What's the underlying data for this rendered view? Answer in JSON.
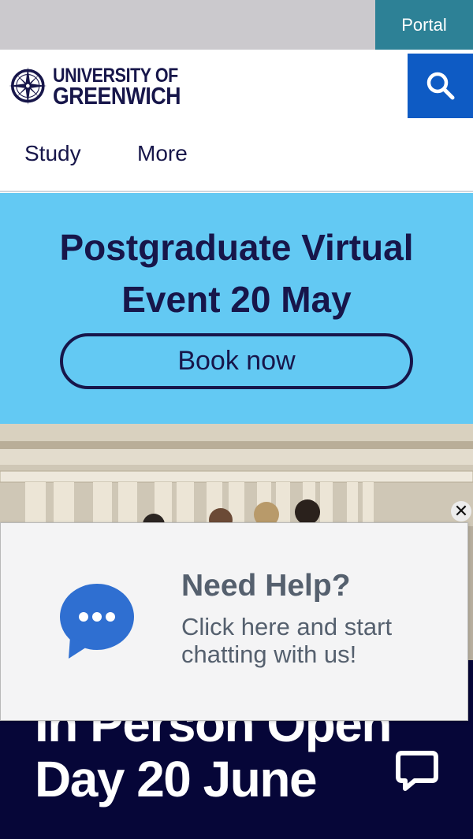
{
  "utility": {
    "portal_label": "Portal"
  },
  "header": {
    "logo_line1": "UNIVERSITY OF",
    "logo_line2": "GREENWICH"
  },
  "nav": {
    "items": [
      {
        "label": "Study"
      },
      {
        "label": "More"
      }
    ]
  },
  "promo": {
    "title_line1": "Postgraduate Virtual",
    "title_line2": "Event 20 May",
    "button_label": "Book now"
  },
  "dark_banner": {
    "title_line1": "In Person Open",
    "title_line2": "Day 20 June"
  },
  "chat_popup": {
    "heading": "Need Help?",
    "message_line1": "Click here and start",
    "message_line2": "chatting with us!",
    "close_glyph": "✕"
  },
  "colors": {
    "navy": "#17164a",
    "portal_teal": "#2d8196",
    "search_blue": "#0e5bc4",
    "promo_sky": "#63c9f3",
    "banner_dark": "#060638",
    "chat_blue": "#2f6fd1"
  },
  "icons": {
    "search": "search-icon",
    "logo": "compass-rose-icon",
    "chat": "chat-bubble-icon",
    "close": "close-icon"
  }
}
